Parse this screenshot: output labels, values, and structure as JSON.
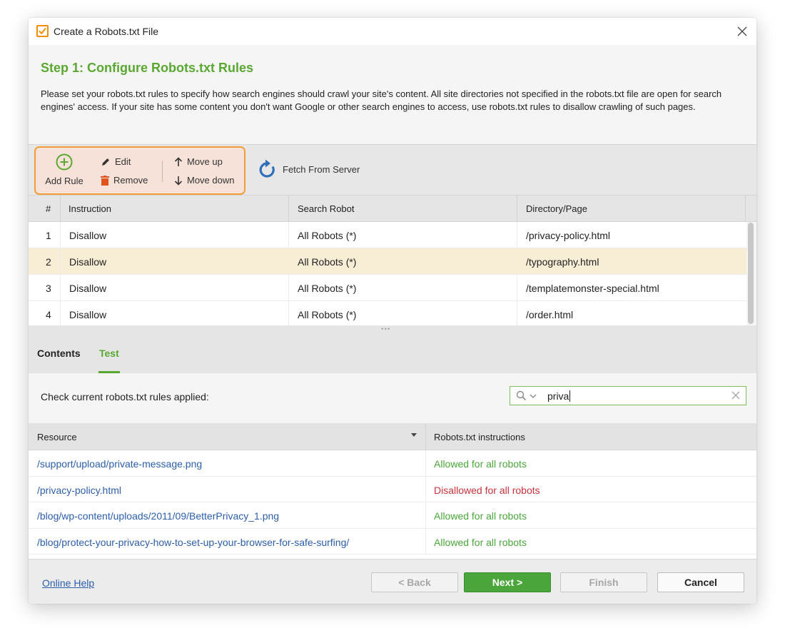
{
  "window": {
    "title": "Create a Robots.txt File",
    "accent": "#5aa832",
    "highlight": "#f29d3a"
  },
  "header": {
    "step_title": "Step 1: Configure Robots.txt Rules",
    "description": "Please set your robots.txt rules to specify how search engines should crawl your site's content. All site directories not specified in the robots.txt file are open for search engines' access. If your site has some content you don't want Google or other search engines to access, use robots.txt rules to disallow crawling of such pages."
  },
  "toolbar": {
    "add_rule": "Add Rule",
    "edit": "Edit",
    "remove": "Remove",
    "move_up": "Move up",
    "move_down": "Move down",
    "fetch": "Fetch From Server"
  },
  "rules": {
    "columns": [
      "#",
      "Instruction",
      "Search Robot",
      "Directory/Page"
    ],
    "rows": [
      {
        "num": "1",
        "instruction": "Disallow",
        "robot": "All Robots (*)",
        "path": "/privacy-policy.html"
      },
      {
        "num": "2",
        "instruction": "Disallow",
        "robot": "All Robots (*)",
        "path": "/typography.html"
      },
      {
        "num": "3",
        "instruction": "Disallow",
        "robot": "All Robots (*)",
        "path": "/templatemonster-special.html"
      },
      {
        "num": "4",
        "instruction": "Disallow",
        "robot": "All Robots (*)",
        "path": "/order.html"
      }
    ],
    "selected_row": 2
  },
  "tabs": {
    "contents": "Contents",
    "test": "Test",
    "active": "Test"
  },
  "test": {
    "label": "Check current robots.txt rules applied:",
    "search_value": "priva"
  },
  "results": {
    "col_resource": "Resource",
    "col_instructions": "Robots.txt instructions",
    "rows": [
      {
        "resource": "/support/upload/private-message.png",
        "status": "Allowed for all robots",
        "allowed": true
      },
      {
        "resource": "/privacy-policy.html",
        "status": "Disallowed for all robots",
        "allowed": false
      },
      {
        "resource": "/blog/wp-content/uploads/2011/09/BetterPrivacy_1.png",
        "status": "Allowed for all robots",
        "allowed": true
      },
      {
        "resource": "/blog/protect-your-privacy-how-to-set-up-your-browser-for-safe-surfing/",
        "status": "Allowed for all robots",
        "allowed": true
      }
    ],
    "allowed_color": "#4aa63a",
    "disallowed_color": "#c8323c"
  },
  "footer": {
    "help": "Online Help",
    "back": "< Back",
    "next": "Next >",
    "finish": "Finish",
    "cancel": "Cancel"
  }
}
